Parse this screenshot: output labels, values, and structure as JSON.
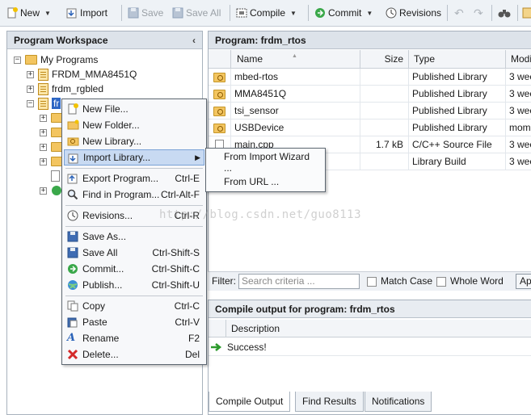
{
  "toolbar": {
    "new": "New",
    "import": "Import",
    "save": "Save",
    "save_all": "Save All",
    "compile": "Compile",
    "commit": "Commit",
    "revisions": "Revisions"
  },
  "workspace": {
    "title": "Program Workspace",
    "collapse": "‹",
    "root": "My Programs",
    "programs": [
      "FRDM_MMA8451Q",
      "frdm_rgbled"
    ],
    "selected_partial": "fr"
  },
  "program": {
    "title": "Program: frdm_rtos",
    "columns": [
      "Name",
      "Size",
      "Type",
      "Modi"
    ],
    "rows": [
      {
        "name": "mbed-rtos",
        "size": "",
        "type": "Published Library",
        "mod": "3 wee"
      },
      {
        "name": "MMA8451Q",
        "size": "",
        "type": "Published Library",
        "mod": "3 wee"
      },
      {
        "name": "tsi_sensor",
        "size": "",
        "type": "Published Library",
        "mod": "3 wee"
      },
      {
        "name": "USBDevice",
        "size": "",
        "type": "Published Library",
        "mod": "mome"
      },
      {
        "name": "main.cpp",
        "size": "1.7 kB",
        "type": "C/C++ Source File",
        "mod": "3 wee"
      },
      {
        "name": "",
        "size": "",
        "type": "Library Build",
        "mod": "3 wee"
      }
    ]
  },
  "filter": {
    "label": "Filter:",
    "placeholder": "Search criteria ...",
    "match_case": "Match Case",
    "whole_word": "Whole Word",
    "apply": "Ap"
  },
  "compile_output": {
    "title": "Compile output for program: frdm_rtos",
    "column": "Description",
    "message": "Success!",
    "tabs": [
      "Compile Output",
      "Find Results",
      "Notifications"
    ]
  },
  "context_menu": {
    "new_file": "New File...",
    "new_folder": "New Folder...",
    "new_library": "New Library...",
    "import_library": "Import Library...",
    "export_program": "Export Program...",
    "export_program_sc": "Ctrl-E",
    "find_in_program": "Find in Program...",
    "find_in_program_sc": "Ctrl-Alt-F",
    "revisions": "Revisions...",
    "revisions_sc": "Ctrl-R",
    "save_as": "Save As...",
    "save_all": "Save All",
    "save_all_sc": "Ctrl-Shift-S",
    "commit": "Commit...",
    "commit_sc": "Ctrl-Shift-C",
    "publish": "Publish...",
    "publish_sc": "Ctrl-Shift-U",
    "copy": "Copy",
    "copy_sc": "Ctrl-C",
    "paste": "Paste",
    "paste_sc": "Ctrl-V",
    "rename": "Rename",
    "rename_sc": "F2",
    "delete": "Delete...",
    "delete_sc": "Del"
  },
  "submenu": {
    "from_wizard": "From Import Wizard",
    "wizard_cont": "...",
    "from_url": "From URL ..."
  },
  "watermark": "http://blog.csdn.net/guo8113",
  "colors": {
    "selection": "#2d66c4",
    "menu_highlight": "#c8daf2",
    "header": "#dde3ea"
  }
}
